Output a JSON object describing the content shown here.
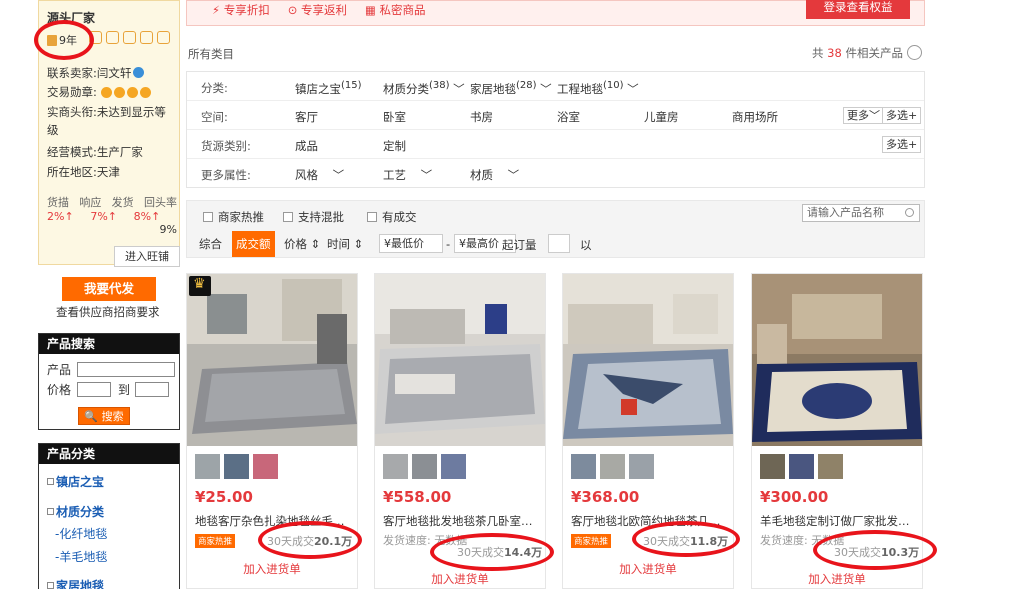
{
  "supplier": {
    "title": "源头厂家",
    "years": "9年",
    "contact_label": "联系卖家:",
    "contact_name": "闫文轩",
    "medal_label": "交易勋章:",
    "headline_label": "实商头衔:",
    "headline_value": "未达到显示等级",
    "mode_label": "经营模式:",
    "mode_value": "生产厂家",
    "region_label": "所在地区:",
    "region_value": "天津",
    "stats_headers": [
      "货描",
      "响应",
      "发货",
      "回头率"
    ],
    "stats_values": [
      "2%↑",
      "7%↑",
      "8%↑"
    ],
    "stats_last": "9%",
    "enter_shop": "进入旺铺",
    "agent_button": "我要代发",
    "agent_link": "查看供应商招商要求"
  },
  "product_search": {
    "header": "产品搜索",
    "product_label": "产品",
    "price_label": "价格",
    "to_label": "到",
    "search_button": "搜索"
  },
  "product_category": {
    "header": "产品分类",
    "items": [
      {
        "label": "镇店之宝",
        "level": "top"
      },
      {
        "label": "材质分类",
        "level": "top"
      },
      {
        "label": "化纤地毯",
        "level": "sub"
      },
      {
        "label": "羊毛地毯",
        "level": "sub"
      },
      {
        "label": "家居地毯",
        "level": "top"
      }
    ]
  },
  "banner": {
    "items": [
      "⚡ 专享折扣",
      "⊙ 专享返利",
      "▦ 私密商品"
    ],
    "button": "登录查看权益"
  },
  "listing": {
    "all_categories": "所有类目",
    "total_prefix": "共",
    "total_count": "38",
    "total_suffix": "件相关产品"
  },
  "filters": {
    "category_label": "分类:",
    "category_options": [
      {
        "name": "镇店之宝",
        "count": "(15)"
      },
      {
        "name": "材质分类",
        "count": "(38)"
      },
      {
        "name": "家居地毯",
        "count": "(28)"
      },
      {
        "name": "工程地毯",
        "count": "(10)"
      }
    ],
    "space_label": "空间:",
    "space_options": [
      "客厅",
      "卧室",
      "书房",
      "浴室",
      "儿童房",
      "商用场所"
    ],
    "more": "更多",
    "multi": "多选",
    "source_label": "货源类别:",
    "source_options": [
      "成品",
      "定制"
    ],
    "attr_label": "更多属性:",
    "attr_options": [
      "风格",
      "工艺",
      "材质"
    ]
  },
  "sortbar": {
    "checks": [
      "商家热推",
      "支持混批",
      "有成交"
    ],
    "search_placeholder": "请输入产品名称",
    "sorts": [
      "综合",
      "成交额",
      "价格",
      "时间"
    ],
    "min_price": "¥最低价",
    "max_price": "¥最高价",
    "moq_label": "起订量",
    "moq_unit": "以"
  },
  "products": [
    {
      "price": "¥25.00",
      "title": "地毯客厅杂色扎染地毯丝毛茶几毯",
      "tag": "商家热推",
      "ship": "",
      "sold": "30天成交",
      "sold_value": "20.1万",
      "add": "加入进货单"
    },
    {
      "price": "¥558.00",
      "title": "客厅地毯批发地毯茶几卧室家用",
      "tag": "",
      "ship": "发货速度: 无数据",
      "sold": "30天成交",
      "sold_value": "14.4万",
      "add": "加入进货单"
    },
    {
      "price": "¥368.00",
      "title": "客厅地毯北欧简约地毯茶几地毯",
      "tag": "商家热推",
      "ship": "",
      "sold": "30天成交",
      "sold_value": "11.8万",
      "add": "加入进货单"
    },
    {
      "price": "¥300.00",
      "title": "羊毛地毯定制订做厂家批发客厅",
      "tag": "",
      "ship": "发货速度: 无数据",
      "sold": "30天成交",
      "sold_value": "10.3万",
      "add": "加入进货单"
    }
  ],
  "colors": {
    "accent": "#ff6a00",
    "price": "#e4393c",
    "highlight": "#e8141b"
  }
}
